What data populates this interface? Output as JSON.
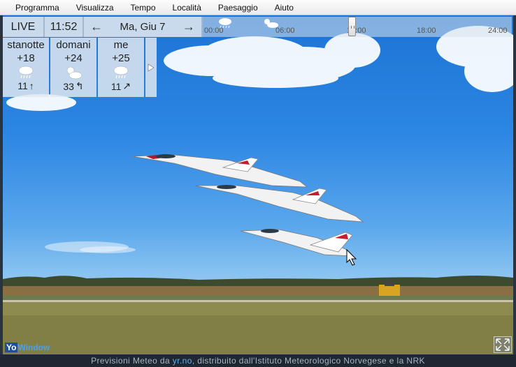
{
  "menu": [
    "Programma",
    "Visualizza",
    "Tempo",
    "Località",
    "Paesaggio",
    "Aiuto"
  ],
  "topbar": {
    "live_label": "LIVE",
    "time": "11:52",
    "date": "Ma, Giu 7",
    "prev_icon": "arrow-left-icon",
    "next_icon": "arrow-right-icon"
  },
  "timeline": {
    "ticks": [
      "00:00",
      "06:00",
      "12:00",
      "18:00",
      "24:00"
    ],
    "current_position": 0.5
  },
  "forecast": [
    {
      "day": "stanotte",
      "temp": "+18",
      "icon": "rain-cloud-icon",
      "wind": "11",
      "wind_dir": "↑"
    },
    {
      "day": "domani",
      "temp": "+24",
      "icon": "sun-cloud-icon",
      "wind": "33",
      "wind_dir": "↰"
    },
    {
      "day": "me",
      "temp": "+25",
      "icon": "rain-cloud-icon",
      "wind": "11",
      "wind_dir": "↗"
    }
  ],
  "logo": {
    "part1": "Yo",
    "part2": "Window"
  },
  "footer": {
    "prefix": "Previsioni Meteo da ",
    "link": "yr.no",
    "suffix": ", distribuito dall'Istituto Meteorologico Norvegese e la NRK"
  },
  "colors": {
    "sky": "#2c86e3",
    "footer_bg": "#1e2732",
    "link": "#5ab0f0"
  }
}
